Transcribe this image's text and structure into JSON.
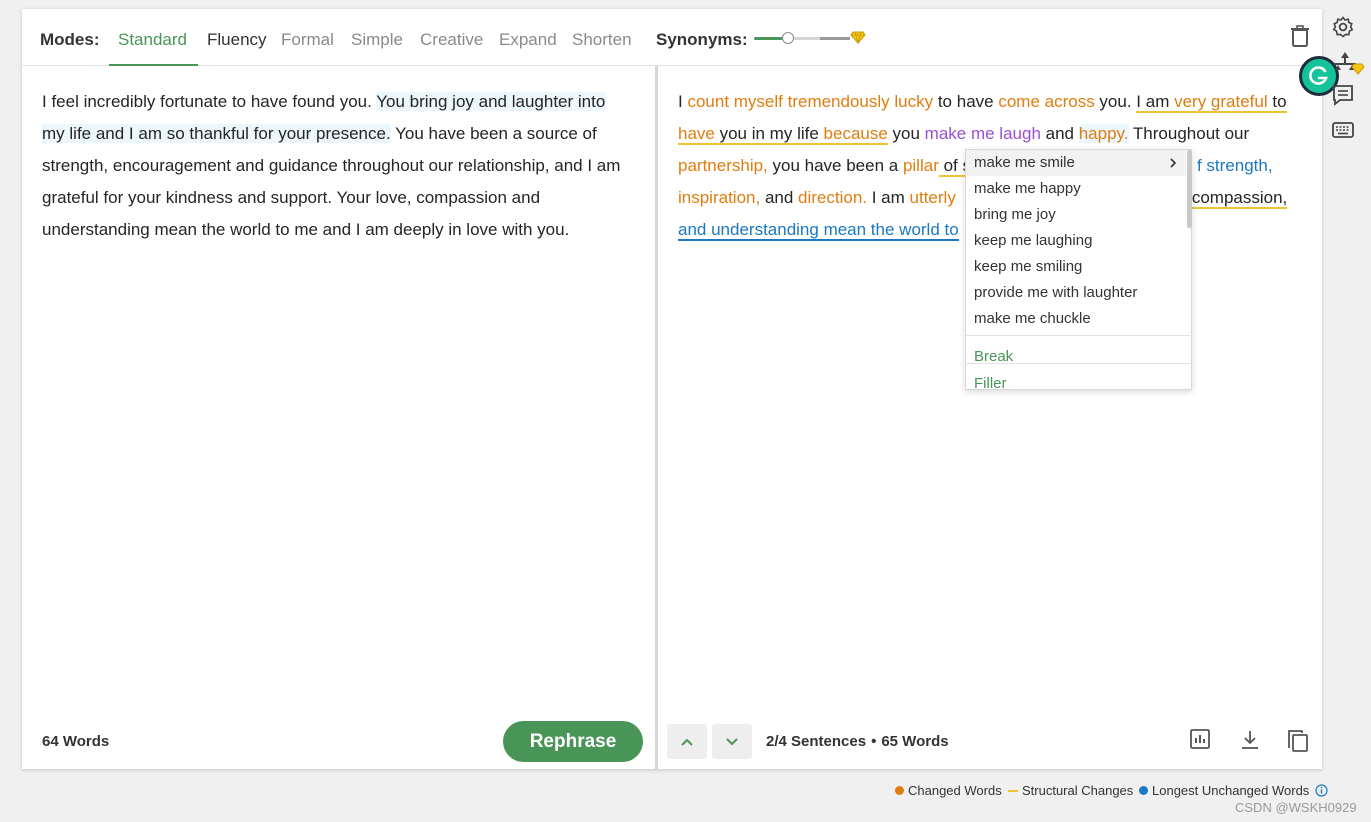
{
  "header": {
    "modes_label": "Modes:",
    "tabs": [
      {
        "label": "Standard",
        "state": "active"
      },
      {
        "label": "Fluency",
        "state": "dark"
      },
      {
        "label": "Formal",
        "state": "premium"
      },
      {
        "label": "Simple",
        "state": "premium"
      },
      {
        "label": "Creative",
        "state": "premium"
      },
      {
        "label": "Expand",
        "state": "premium"
      },
      {
        "label": "Shorten",
        "state": "premium"
      }
    ],
    "synonyms_label": "Synonyms:",
    "synonyms_level_fraction": 0.35
  },
  "input": {
    "segments": [
      {
        "text": "I feel incredibly fortunate to have found you. ",
        "style": "plain"
      },
      {
        "text": "You bring joy and laughter into my life and I am so thankful for your presence.",
        "style": "highlight"
      },
      {
        "text": " You have been a source of strength, encouragement and guidance throughout our relationship, and I am grateful for your kindness and support. Your love, compassion and understanding mean the world to me and I am deeply in love with you.",
        "style": "plain"
      }
    ],
    "word_count": "64 Words",
    "rephrase_label": "Rephrase"
  },
  "output": {
    "text_parts": {
      "p1": "I ",
      "p2": "count myself tremendously lucky",
      "p3": " to have ",
      "p4": "come across",
      "p5": " you. ",
      "p6": "I am ",
      "p7": "very grateful",
      "p8": " to",
      "p9": "have",
      "p10": " you in my life ",
      "p11": "because",
      "p12": " you ",
      "p13": "make me laugh",
      "p14": " and ",
      "p15": "happy.",
      "p16": " Throughout our",
      "p17": "partnership,",
      "p18": " you have been a ",
      "p19": "pillar",
      "p20": " of s",
      "p21": "f strength,",
      "p22": "inspiration,",
      "p23": " and ",
      "p24": "direction.",
      "p25": " I am ",
      "p26": "utterly",
      "p27": "compassion,",
      "p28": "and understanding mean the world to"
    },
    "sentence_info": "2/4 Sentences",
    "word_count": "65 Words"
  },
  "dropdown": {
    "options": [
      "make me smile",
      "make me happy",
      "bring me joy",
      "keep me laughing",
      "keep me smiling",
      "provide me with laughter",
      "make me chuckle"
    ],
    "extra": [
      "Break",
      "Filler"
    ]
  },
  "legend": {
    "changed": "Changed Words",
    "structural": "Structural Changes",
    "unchanged": "Longest Unchanged Words"
  },
  "colors": {
    "accent": "#499557",
    "changed": "#e07d10",
    "structural": "#f0c330",
    "unchanged": "#1b78c2"
  },
  "watermark": "CSDN @WSKH0929"
}
